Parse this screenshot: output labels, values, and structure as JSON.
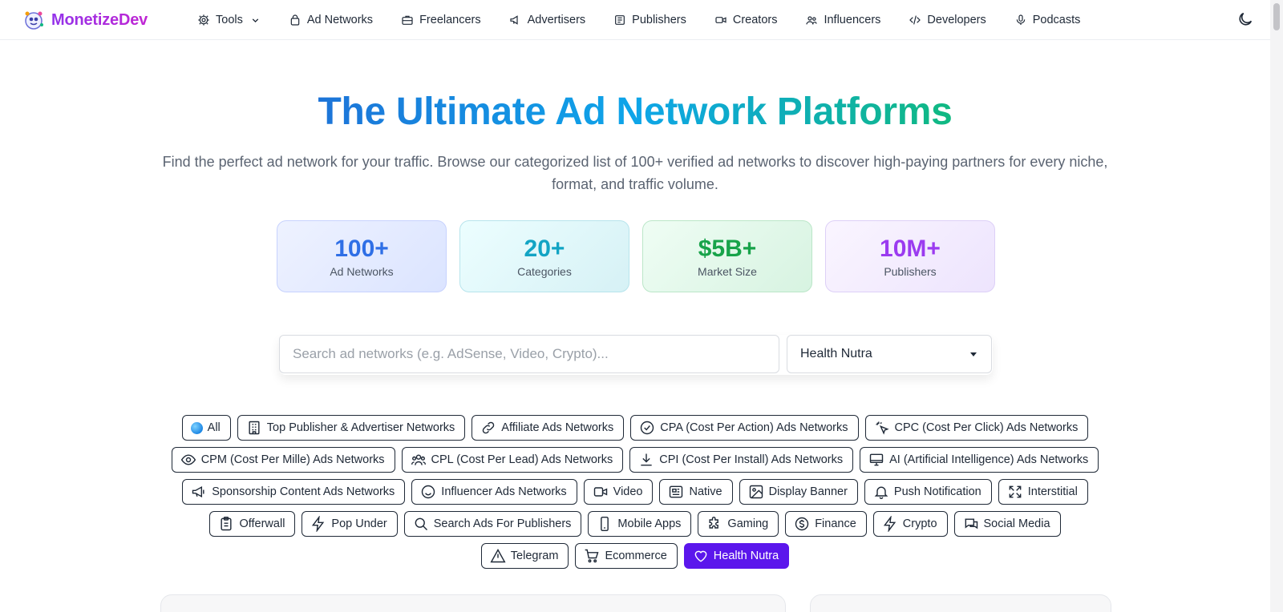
{
  "brand": {
    "name": "MonetizeDev"
  },
  "nav": {
    "items": [
      {
        "label": "Tools",
        "icon": "gear-icon",
        "dropdown": true
      },
      {
        "label": "Ad Networks",
        "icon": "bag-icon"
      },
      {
        "label": "Freelancers",
        "icon": "briefcase-icon"
      },
      {
        "label": "Advertisers",
        "icon": "megaphone-icon"
      },
      {
        "label": "Publishers",
        "icon": "newspaper-icon"
      },
      {
        "label": "Creators",
        "icon": "video-camera-icon"
      },
      {
        "label": "Influencers",
        "icon": "users-icon"
      },
      {
        "label": "Developers",
        "icon": "code-icon"
      },
      {
        "label": "Podcasts",
        "icon": "microphone-icon"
      }
    ],
    "theme_toggle_icon": "moon-icon"
  },
  "hero": {
    "title": "The Ultimate Ad Network Platforms",
    "subtitle": "Find the perfect ad network for your traffic. Browse our categorized list of 100+ verified ad networks to discover high-paying partners for every niche, format, and traffic volume."
  },
  "stats": [
    {
      "value": "100+",
      "label": "Ad Networks",
      "color": "#2f6fe6"
    },
    {
      "value": "20+",
      "label": "Categories",
      "color": "#12a4c4"
    },
    {
      "value": "$5B+",
      "label": "Market Size",
      "color": "#18a34a"
    },
    {
      "value": "10M+",
      "label": "Publishers",
      "color": "#9b3bf0"
    }
  ],
  "search": {
    "placeholder": "Search ad networks (e.g. AdSense, Video, Crypto)...",
    "value": "",
    "category_selected": "Health Nutra"
  },
  "categories": [
    {
      "label": "All",
      "icon": "globe-icon"
    },
    {
      "label": "Top Publisher & Advertiser Networks",
      "icon": "building-icon"
    },
    {
      "label": "Affiliate Ads Networks",
      "icon": "link-icon"
    },
    {
      "label": "CPA (Cost Per Action) Ads Networks",
      "icon": "check-circle-icon"
    },
    {
      "label": "CPC (Cost Per Click) Ads Networks",
      "icon": "cursor-click-icon"
    },
    {
      "label": "CPM (Cost Per Mille) Ads Networks",
      "icon": "eye-icon"
    },
    {
      "label": "CPL (Cost Per Lead) Ads Networks",
      "icon": "users-icon"
    },
    {
      "label": "CPI (Cost Per Install) Ads Networks",
      "icon": "download-icon"
    },
    {
      "label": "AI (Artificial Intelligence) Ads Networks",
      "icon": "monitor-icon"
    },
    {
      "label": "Sponsorship Content Ads Networks",
      "icon": "megaphone-icon"
    },
    {
      "label": "Influencer Ads Networks",
      "icon": "smile-icon"
    },
    {
      "label": "Video",
      "icon": "video-camera-icon"
    },
    {
      "label": "Native",
      "icon": "newspaper-icon"
    },
    {
      "label": "Display Banner",
      "icon": "image-icon"
    },
    {
      "label": "Push Notification",
      "icon": "bell-icon"
    },
    {
      "label": "Interstitial",
      "icon": "expand-icon"
    },
    {
      "label": "Offerwall",
      "icon": "clipboard-icon"
    },
    {
      "label": "Pop Under",
      "icon": "zap-icon"
    },
    {
      "label": "Search Ads For Publishers",
      "icon": "search-icon"
    },
    {
      "label": "Mobile Apps",
      "icon": "smartphone-icon"
    },
    {
      "label": "Gaming",
      "icon": "puzzle-icon"
    },
    {
      "label": "Finance",
      "icon": "dollar-circle-icon"
    },
    {
      "label": "Crypto",
      "icon": "zap-icon"
    },
    {
      "label": "Social Media",
      "icon": "chat-bubbles-icon"
    },
    {
      "label": "Telegram",
      "icon": "triangle-alert-icon"
    },
    {
      "label": "Ecommerce",
      "icon": "cart-icon"
    },
    {
      "label": "Health Nutra",
      "icon": "heart-icon",
      "active": true
    }
  ],
  "colors": {
    "active_chip": "#5b16ec",
    "brand": "#a021d8"
  }
}
